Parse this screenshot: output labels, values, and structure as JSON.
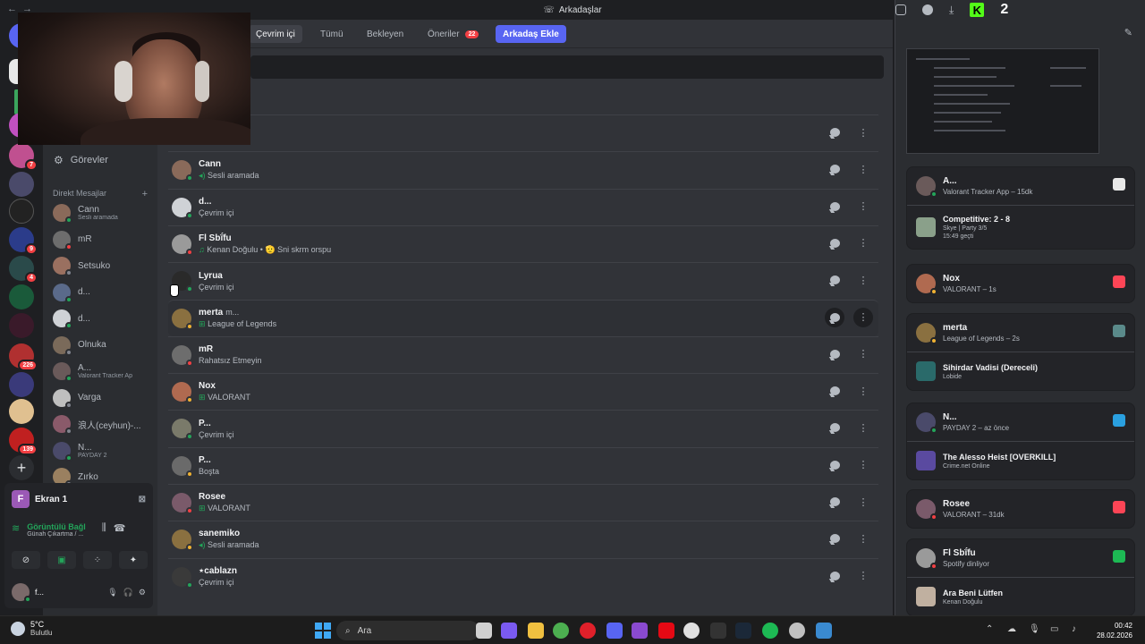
{
  "window": {
    "title": "Arkadaşlar"
  },
  "tabs": [
    {
      "label": "Çevrim içi",
      "active": true
    },
    {
      "label": "Tümü"
    },
    {
      "label": "Bekleyen"
    },
    {
      "label": "Öneriler",
      "badge": "22"
    },
    {
      "label": "Arkadaş Ekle"
    }
  ],
  "kick_badge": "2",
  "server_badges": [
    "7",
    "9",
    "4",
    "226",
    "139"
  ],
  "sidebar": {
    "tasks": "Görevler",
    "dm_header": "Direkt Mesajlar",
    "dm_add": "+",
    "dms": [
      {
        "name": "Cann",
        "sub": "Sesli aramada",
        "status": "online",
        "color": "#8a6a5a"
      },
      {
        "name": "mR",
        "sub": "",
        "status": "dnd",
        "color": "#6d6d6d"
      },
      {
        "name": "Setsuko",
        "sub": "",
        "status": "off",
        "color": "#9a7060"
      },
      {
        "name": "d...",
        "sub": "",
        "status": "online",
        "color": "#5a6a8a"
      },
      {
        "name": "d...",
        "sub": "",
        "status": "online",
        "color": "#cfd2d6"
      },
      {
        "name": "Olnuka",
        "sub": "",
        "status": "off",
        "color": "#7a6a5a"
      },
      {
        "name": "A...",
        "sub": "Valorant Tracker Ap",
        "status": "online",
        "color": "#6a5a5a"
      },
      {
        "name": "Varga",
        "sub": "",
        "status": "off",
        "color": "#bfbfbf"
      },
      {
        "name": "浪人(ceyhun)-...",
        "sub": "",
        "status": "off",
        "color": "#8a5a6a"
      },
      {
        "name": "N...",
        "sub": "PAYDAY 2",
        "status": "online",
        "color": "#4a4a6a"
      },
      {
        "name": "Zırko",
        "sub": "",
        "status": "off",
        "color": "#9a8060"
      }
    ]
  },
  "voice": {
    "screen_label": "Ekran 1",
    "screen_initial": "F",
    "conn_title": "Görüntülü Bağl",
    "conn_sub": "Günah Çıkartma / ...",
    "user_name": "f..."
  },
  "friends": [
    {
      "name": "",
      "tag": "",
      "sub": "",
      "status": "online",
      "color": "#444"
    },
    {
      "name": "Cann",
      "tag": "",
      "sub": "Sesli aramada",
      "sub_icon": "speaker",
      "status": "online",
      "color": "#8a6a5a"
    },
    {
      "name": "d...",
      "tag": "",
      "sub": "Çevrim içi",
      "status": "online",
      "color": "#cfd2d6"
    },
    {
      "name": "Fl Sbḯfu",
      "tag": "",
      "sub": "Kenan Doğulu • 🫡 Sni skrm orspu",
      "sub_icon": "music",
      "status": "dnd",
      "color": "#9a9a9a"
    },
    {
      "name": "Lyrua",
      "tag": "",
      "sub": "Çevrim içi",
      "status": "online",
      "color": "#2a2a2a"
    },
    {
      "name": "merta",
      "tag": "m...",
      "sub": "League of Legends",
      "sub_icon": "game",
      "status": "idle",
      "color": "#8a7040",
      "hover": true
    },
    {
      "name": "mR",
      "tag": "",
      "sub": "Rahatsız Etmeyin",
      "status": "dnd",
      "color": "#6d6d6d"
    },
    {
      "name": "Nox",
      "tag": "",
      "sub": "VALORANT",
      "sub_icon": "game",
      "status": "idle",
      "color": "#b06a50"
    },
    {
      "name": "P...",
      "tag": "",
      "sub": "Çevrim içi",
      "status": "online",
      "color": "#7a7a6a"
    },
    {
      "name": "P...",
      "tag": "",
      "sub": "Boşta",
      "status": "idle",
      "color": "#6a6a6a"
    },
    {
      "name": "Rosee",
      "tag": "",
      "sub": "VALORANT",
      "sub_icon": "game",
      "status": "dnd",
      "color": "#7a5a6a"
    },
    {
      "name": "sanemiko",
      "tag": "",
      "sub": "Sesli aramada",
      "sub_icon": "speaker",
      "status": "idle",
      "color": "#8a7040"
    },
    {
      "name": "⋆cablazn",
      "tag": "",
      "sub": "Çevrim içi",
      "status": "online",
      "color": "#3a3a3a"
    }
  ],
  "activity": [
    {
      "name": "A...",
      "sub": "Valorant Tracker App – 15dk",
      "status": "online",
      "color": "#6a5a5a",
      "icon_color": "#e8e8e8",
      "detail": {
        "title": "Competitive: 2 - 8",
        "line1": "Skye | Party 3/5",
        "line2": "15:49 geçti",
        "thumb": "#8aa08a"
      }
    },
    {
      "name": "Nox",
      "sub": "VALORANT – 1s",
      "status": "idle",
      "color": "#b06a50",
      "icon_color": "#fd4556"
    },
    {
      "name": "merta",
      "sub": "League of Legends – 2s",
      "status": "idle",
      "color": "#8a7040",
      "icon_color": "#5a8a8a",
      "detail": {
        "title": "Sihirdar Vadisi (Dereceli)",
        "line1": "Lobide",
        "line2": "",
        "thumb": "#2a6a6a"
      }
    },
    {
      "name": "N...",
      "sub": "PAYDAY 2 – az önce",
      "status": "online",
      "color": "#4a4a6a",
      "icon_color": "#2aa0e0",
      "detail": {
        "title": "The Alesso Heist [OVERKILL]",
        "line1": "Crime.net Online",
        "line2": "",
        "thumb": "#5a4aa0"
      }
    },
    {
      "name": "Rosee",
      "sub": "VALORANT – 31dk",
      "status": "dnd",
      "color": "#7a5a6a",
      "icon_color": "#fd4556"
    },
    {
      "name": "Fl Sbḯfu",
      "sub": "Spotify dinliyor",
      "status": "dnd",
      "color": "#9a9a9a",
      "icon_color": "#1db954",
      "detail": {
        "title": "Ara Beni Lütfen",
        "line1": "Kenan Doğulu",
        "line2": "",
        "thumb": "#c0b0a0"
      }
    }
  ],
  "taskbar": {
    "temp": "5°C",
    "weather": "Bulutlu",
    "search_placeholder": "Ara",
    "time": "00:42",
    "date": "28.02.2026"
  }
}
